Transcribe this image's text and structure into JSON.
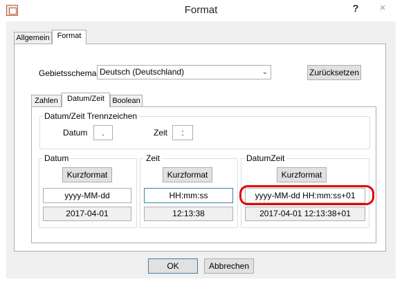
{
  "window": {
    "title": "Format",
    "help_glyph": "?",
    "close_glyph": "×"
  },
  "tabs": {
    "outer": [
      "Allgemein",
      "Format"
    ],
    "inner": [
      "Zahlen",
      "Datum/Zeit",
      "Boolean"
    ]
  },
  "locale": {
    "label": "Gebietsschema",
    "value": "Deutsch (Deutschland)",
    "reset": "Zurücksetzen"
  },
  "separators": {
    "title": "Datum/Zeit Trennzeichen",
    "date_label": "Datum",
    "date_value": ".",
    "time_label": "Zeit",
    "time_value": ":"
  },
  "groups": {
    "date": {
      "title": "Datum",
      "button": "Kurzformat",
      "format": "yyyy-MM-dd",
      "preview": "2017-04-01"
    },
    "time": {
      "title": "Zeit",
      "button": "Kurzformat",
      "format": "HH:mm:ss",
      "preview": "12:13:38"
    },
    "datetime": {
      "title": "DatumZeit",
      "button": "Kurzformat",
      "format": "yyyy-MM-dd HH:mm:ss+01",
      "preview": "2017-04-01 12:13:38+01"
    }
  },
  "footer": {
    "ok": "OK",
    "cancel": "Abbrechen"
  },
  "annotation_color": "#e00000"
}
